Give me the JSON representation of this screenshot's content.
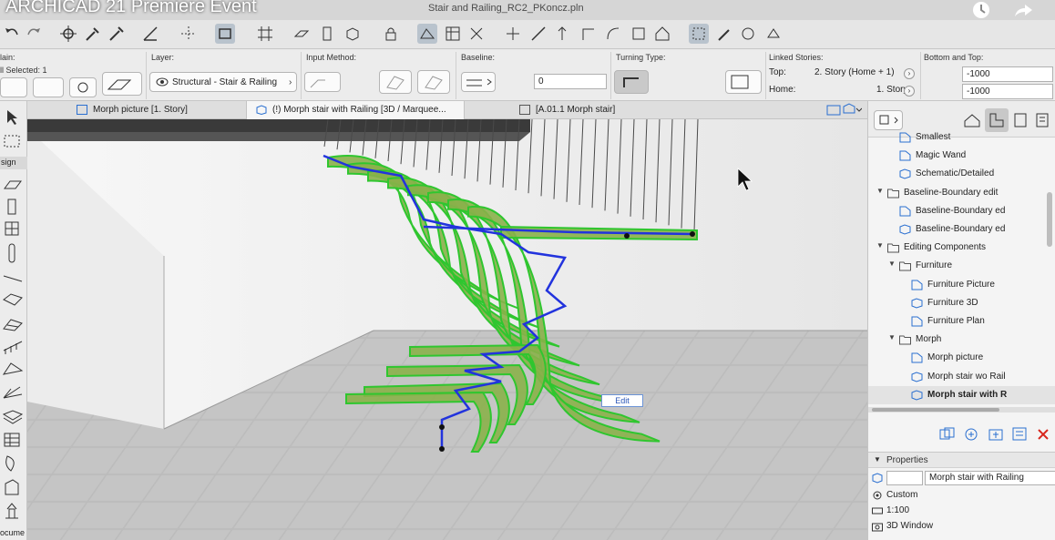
{
  "video": {
    "title": "ARCHICAD 21 Premiere Event"
  },
  "window": {
    "file_title": "Stair and Railing_RC2_PKoncz.pln"
  },
  "infobox": {
    "main_label": "lain:",
    "selected_label": "ll Selected: 1",
    "layer_label": "Layer:",
    "layer_value": "Structural - Stair & Railing",
    "input_method_label": "Input Method:",
    "baseline_label": "Baseline:",
    "baseline_value": "0",
    "turning_type_label": "Turning Type:",
    "linked_stories_label": "Linked Stories:",
    "top_label": "Top:",
    "top_value": "2. Story (Home + 1)",
    "home_label": "Home:",
    "home_value": "1. Story",
    "bottom_top_label": "Bottom and Top:",
    "top_offset": "-1000",
    "bottom_offset": "-1000"
  },
  "tabs": [
    {
      "label": "Morph picture [1. Story]",
      "active": false
    },
    {
      "label": "(!) Morph stair with Railing [3D / Marquee...",
      "active": true
    },
    {
      "label": "[A.01.1 Morph stair]",
      "active": false
    }
  ],
  "toolbox": {
    "design_label": "sign",
    "document_label": "ocume"
  },
  "viewport": {
    "edit_label": "Edit",
    "stair_color": "#8ab04a",
    "edge_color": "#2fc62f",
    "railing_color": "#2233dd"
  },
  "navigator": {
    "items": [
      {
        "label": "Smallest",
        "indent": 2,
        "kind": "view",
        "expander": ""
      },
      {
        "label": "Magic Wand",
        "indent": 2,
        "kind": "view",
        "expander": ""
      },
      {
        "label": "Schematic/Detailed",
        "indent": 2,
        "kind": "view3d",
        "expander": ""
      },
      {
        "label": "Baseline-Boundary edit",
        "indent": 1,
        "kind": "folder",
        "expander": "▼"
      },
      {
        "label": "Baseline-Boundary ed",
        "indent": 2,
        "kind": "view",
        "expander": ""
      },
      {
        "label": "Baseline-Boundary ed",
        "indent": 2,
        "kind": "view3d",
        "expander": ""
      },
      {
        "label": "Editing Components",
        "indent": 1,
        "kind": "folder",
        "expander": "▼"
      },
      {
        "label": "Furniture",
        "indent": 2,
        "kind": "folder",
        "expander": "▼"
      },
      {
        "label": "Furniture Picture",
        "indent": 3,
        "kind": "view",
        "expander": ""
      },
      {
        "label": "Furniture 3D",
        "indent": 3,
        "kind": "view3d",
        "expander": ""
      },
      {
        "label": "Furniture Plan",
        "indent": 3,
        "kind": "view",
        "expander": ""
      },
      {
        "label": "Morph",
        "indent": 2,
        "kind": "folder",
        "expander": "▼"
      },
      {
        "label": "Morph picture",
        "indent": 3,
        "kind": "view",
        "expander": ""
      },
      {
        "label": "Morph stair wo Rail",
        "indent": 3,
        "kind": "view3d",
        "expander": ""
      },
      {
        "label": "Morph stair with R",
        "indent": 3,
        "kind": "view3d",
        "expander": "",
        "selected": true
      }
    ],
    "properties": {
      "header": "Properties",
      "name_value": "Morph stair with Railing",
      "custom": "Custom",
      "scale": "1:100",
      "window_type": "3D Window"
    }
  }
}
